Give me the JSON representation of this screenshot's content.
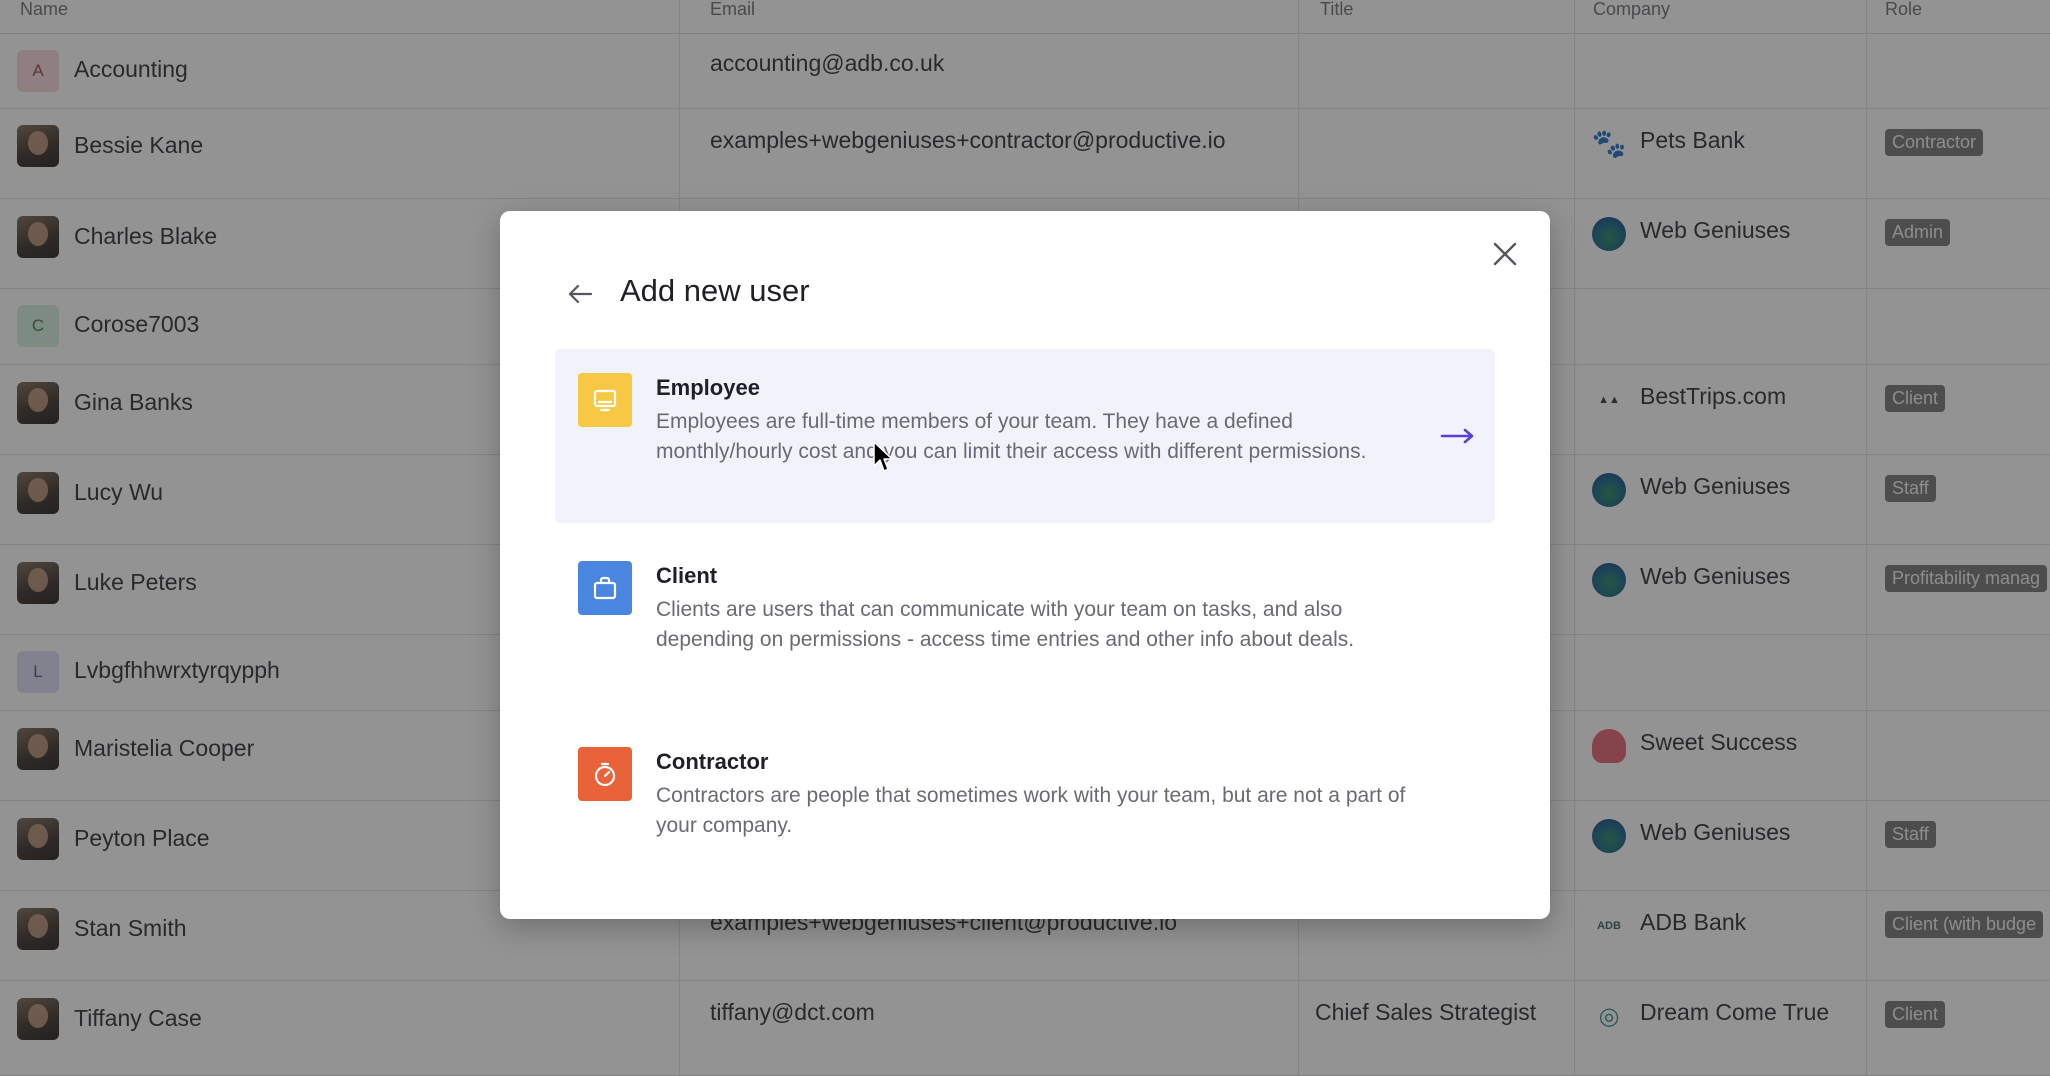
{
  "table": {
    "headers": [
      "Name",
      "Email",
      "Title",
      "Company",
      "Role"
    ],
    "rows": [
      {
        "name": "Accounting",
        "initial": "A",
        "email": "accounting@adb.co.uk",
        "title": "",
        "company": "",
        "role": ""
      },
      {
        "name": "Bessie Kane",
        "email": "examples+webgeniuses+contractor@productive.io",
        "title": "",
        "company": "Pets Bank",
        "role": "Contractor"
      },
      {
        "name": "Charles Blake",
        "email": "",
        "title": "",
        "company": "Web Geniuses",
        "role": "Admin"
      },
      {
        "name": "Corose7003",
        "initial": "C",
        "email": "",
        "title": "",
        "company": "",
        "role": ""
      },
      {
        "name": "Gina Banks",
        "email": "",
        "title": "",
        "company": "BestTrips.com",
        "role": "Client"
      },
      {
        "name": "Lucy Wu",
        "email": "",
        "title": "",
        "company": "Web Geniuses",
        "role": "Staff"
      },
      {
        "name": "Luke Peters",
        "email": "",
        "title": "",
        "company": "Web Geniuses",
        "role": "Profitability manag"
      },
      {
        "name": "Lvbgfhhwrxtyrqypph",
        "initial": "L",
        "email": "",
        "title": "",
        "company": "",
        "role": ""
      },
      {
        "name": "Maristelia Cooper",
        "email": "",
        "title": "",
        "company": "Sweet Success",
        "role": ""
      },
      {
        "name": "Peyton Place",
        "email": "",
        "title": "",
        "company": "Web Geniuses",
        "role": "Staff"
      },
      {
        "name": "Stan Smith",
        "email": "examples+webgeniuses+client@productive.io",
        "title": "",
        "company": "ADB Bank",
        "role": "Client (with budge"
      },
      {
        "name": "Tiffany Case",
        "email": "tiffany@dct.com",
        "title": "Chief Sales Strategist",
        "company": "Dream Come True",
        "role": "Client"
      }
    ]
  },
  "modal": {
    "title": "Add new user",
    "options": [
      {
        "title": "Employee",
        "description": "Employees are full-time members of your team. They have a defined monthly/hourly cost and you can limit their access with different permissions.",
        "icon": "monitor-icon",
        "color": "#f7c844"
      },
      {
        "title": "Client",
        "description": "Clients are users that can communicate with your team on tasks, and also depending on permissions - access time entries and other info about deals.",
        "icon": "briefcase-icon",
        "color": "#4a86e0"
      },
      {
        "title": "Contractor",
        "description": "Contractors are people that sometimes work with your team, but are not a part of your company.",
        "icon": "stopwatch-icon",
        "color": "#e8623a"
      }
    ]
  },
  "colors": {
    "accent": "#5b3fd6",
    "highlight": "#f2f2fd",
    "role_badge": "#737373"
  }
}
